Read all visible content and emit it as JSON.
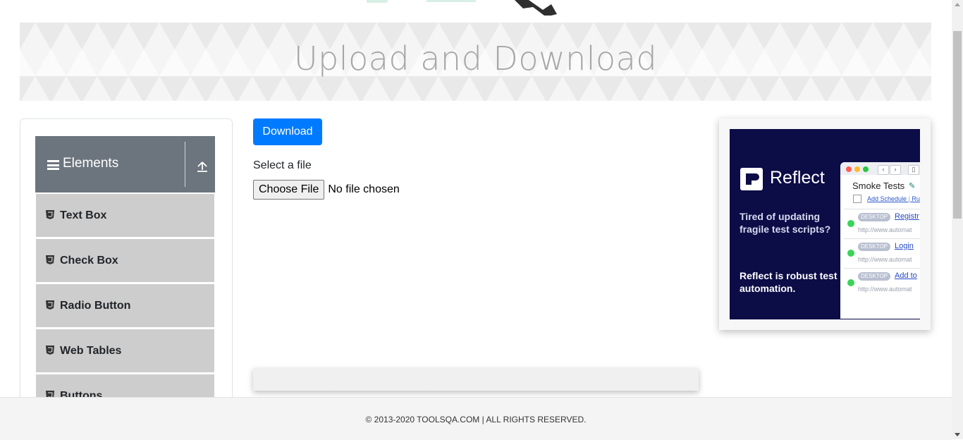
{
  "page": {
    "title": "Upload and Download",
    "footer": "© 2013-2020 TOOLSQA.COM | ALL RIGHTS RESERVED."
  },
  "sidebar": {
    "group_title": "Elements",
    "items": [
      {
        "label": "Text Box"
      },
      {
        "label": "Check Box"
      },
      {
        "label": "Radio Button"
      },
      {
        "label": "Web Tables"
      },
      {
        "label": "Buttons"
      }
    ]
  },
  "main": {
    "download_label": "Download",
    "select_label": "Select a file",
    "choose_file_label": "Choose File",
    "file_status": "No file chosen"
  },
  "ad": {
    "brand": "Reflect",
    "headline": "Tired of updating fragile test scripts?",
    "tagline": "Reflect is robust test automation.",
    "panel_title": "Smoke Tests",
    "schedule_link": "Add Schedule",
    "schedule_extra": "Ru",
    "rows": [
      {
        "tag": "DESKTOP",
        "link": "Registr",
        "url": "http://www.automat"
      },
      {
        "tag": "DESKTOP",
        "link": "Login",
        "url": "http://www.automat"
      },
      {
        "tag": "DESKTOP",
        "link": "Add to",
        "url": "http://www.automat"
      }
    ]
  },
  "colors": {
    "primary": "#007bff",
    "group_header": "#6c757d",
    "menu_item": "#cdcdcd",
    "ad_background": "#0c0c47",
    "status_green": "#3ad35a"
  },
  "icons": {
    "group": "hamburger-icon",
    "collapse": "collapse-up-icon",
    "menu_item": "html5-shield-icon"
  }
}
